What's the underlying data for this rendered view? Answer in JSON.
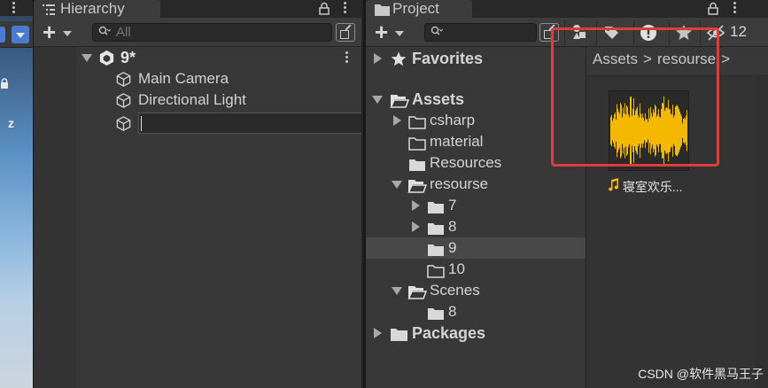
{
  "hierarchy": {
    "tab_label": "Hierarchy",
    "search_placeholder": "All",
    "scene_name": "9*",
    "items": [
      {
        "label": "Main Camera"
      },
      {
        "label": "Directional Light"
      }
    ],
    "rename_value": ""
  },
  "project": {
    "tab_label": "Project",
    "search_placeholder": "",
    "hidden_count": "12",
    "favorites_label": "Favorites",
    "assets_label": "Assets",
    "folders": {
      "csharp": "csharp",
      "material": "material",
      "resources": "Resources",
      "resourse": "resourse",
      "f7": "7",
      "f8": "8",
      "f9": "9",
      "f10": "10",
      "scenes": "Scenes",
      "scenes_8": "8"
    },
    "packages_label": "Packages",
    "breadcrumb": [
      "Assets",
      "resourse"
    ],
    "asset": {
      "name": "寝室欢乐...",
      "type_icon": "music-note-icon",
      "waveform_color": "#f5b800"
    }
  },
  "colors": {
    "selection": "#484848",
    "highlight_box": "#e23b3b"
  },
  "watermark": "CSDN @软件黑马王子"
}
